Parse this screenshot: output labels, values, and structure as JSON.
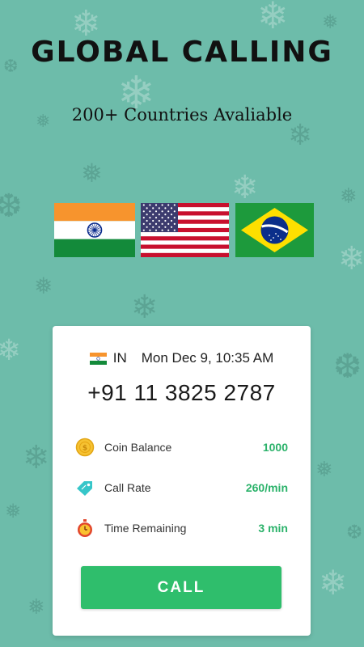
{
  "header": {
    "title": "GLOBAL CALLING",
    "subtitle": "200+ Countries Avaliable"
  },
  "flags": [
    "india-flag",
    "usa-flag",
    "brazil-flag"
  ],
  "card": {
    "country_code": "IN",
    "datetime": "Mon Dec 9, 10:35 AM",
    "phone_number": "+91 11 3825 2787",
    "rows": [
      {
        "icon": "coin-icon",
        "label": "Coin Balance",
        "value": "1000"
      },
      {
        "icon": "price-tag-icon",
        "label": "Call Rate",
        "value": "260/min"
      },
      {
        "icon": "stopwatch-icon",
        "label": "Time Remaining",
        "value": "3 min"
      }
    ],
    "call_button": "CALL"
  },
  "colors": {
    "background": "#6dbcaa",
    "accent_green": "#2fbe6c",
    "value_green": "#2bb26a"
  }
}
